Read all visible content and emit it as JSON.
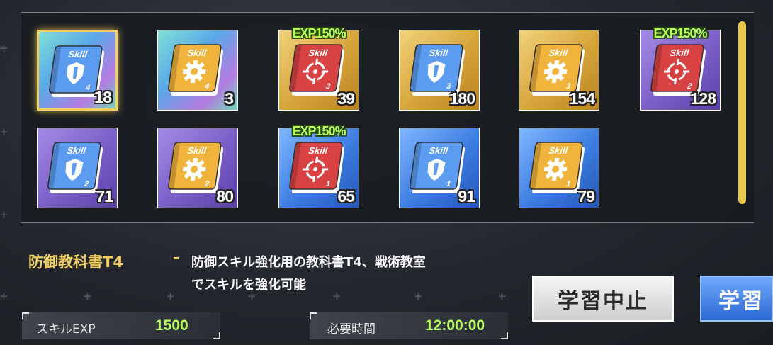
{
  "items": [
    {
      "type": "defense",
      "tier": "4",
      "qty": "18",
      "bonus": "",
      "rarity": "rainbow",
      "selected": true
    },
    {
      "type": "support",
      "tier": "4",
      "qty": "3",
      "bonus": "",
      "rarity": "rainbow",
      "selected": false
    },
    {
      "type": "attack",
      "tier": "3",
      "qty": "39",
      "bonus": "EXP150%",
      "rarity": "gold",
      "selected": false
    },
    {
      "type": "defense",
      "tier": "3",
      "qty": "180",
      "bonus": "",
      "rarity": "gold",
      "selected": false
    },
    {
      "type": "support",
      "tier": "3",
      "qty": "154",
      "bonus": "",
      "rarity": "gold",
      "selected": false
    },
    {
      "type": "attack",
      "tier": "2",
      "qty": "128",
      "bonus": "EXP150%",
      "rarity": "purple",
      "selected": false
    },
    {
      "type": "defense",
      "tier": "2",
      "qty": "71",
      "bonus": "",
      "rarity": "purple",
      "selected": false
    },
    {
      "type": "support",
      "tier": "2",
      "qty": "80",
      "bonus": "",
      "rarity": "purple",
      "selected": false
    },
    {
      "type": "attack",
      "tier": "1",
      "qty": "65",
      "bonus": "EXP150%",
      "rarity": "blue",
      "selected": false
    },
    {
      "type": "defense",
      "tier": "1",
      "qty": "91",
      "bonus": "",
      "rarity": "blue",
      "selected": false
    },
    {
      "type": "support",
      "tier": "1",
      "qty": "79",
      "bonus": "",
      "rarity": "blue",
      "selected": false
    }
  ],
  "book_label": "Skill",
  "icons": {
    "defense": "shield-icon",
    "support": "gear-icon",
    "attack": "crosshair-icon"
  },
  "colors": {
    "defense_book": "#5b9cf0",
    "support_book": "#f0b33c",
    "attack_book": "#d94242",
    "rainbow": "#5fc6c0",
    "gold": "#d9a93a",
    "purple": "#7b5ec6",
    "blue": "#3d7de0",
    "accent": "#f2cf63",
    "value_green": "#b8ff5e"
  },
  "detail": {
    "title": "防御教科書T4",
    "separator": "-",
    "description_line1": "防御スキル強化用の教科書T4、戦術教室",
    "description_line2": "でスキルを強化可能"
  },
  "stats": {
    "skill_exp_label": "スキルEXP",
    "skill_exp_value": "1500",
    "time_label": "必要時間",
    "time_value": "12:00:00"
  },
  "buttons": {
    "stop": "学習中止",
    "learn": "学習"
  }
}
